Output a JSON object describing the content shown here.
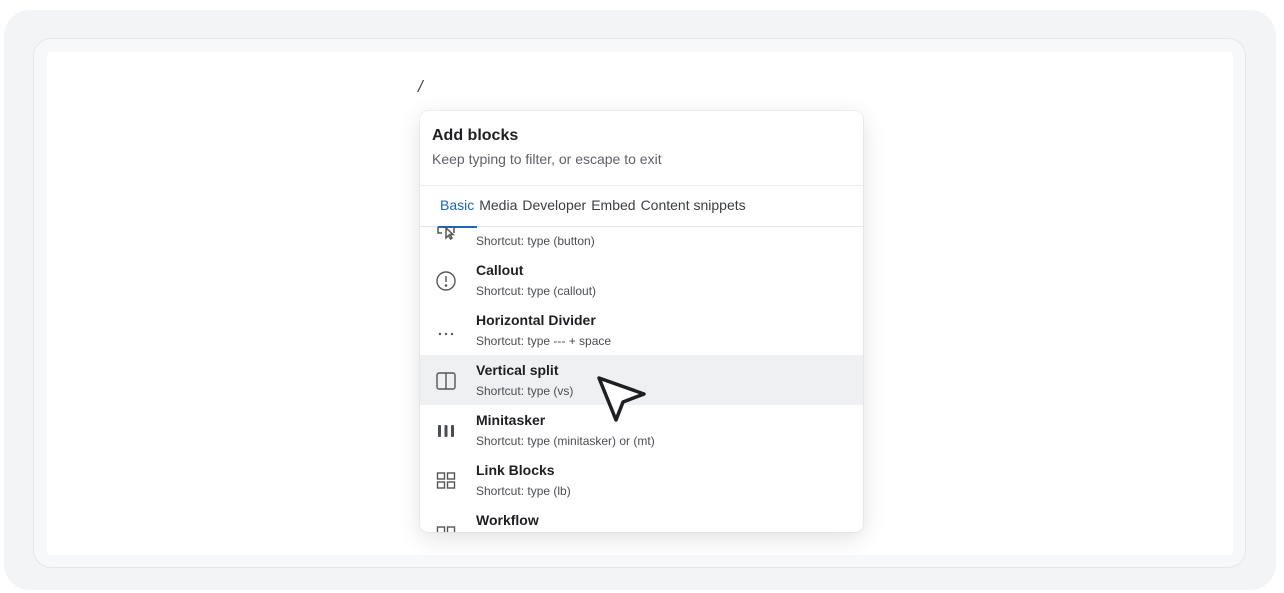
{
  "editor": {
    "slash": "/"
  },
  "menu": {
    "title": "Add blocks",
    "subtitle": "Keep typing to filter, or escape to exit",
    "tabs": [
      "Basic",
      "Media",
      "Developer",
      "Embed",
      "Content snippets"
    ],
    "active_tab": "Basic",
    "items": [
      {
        "name": "",
        "shortcut": "Shortcut: type (button)",
        "icon": "button-cursor-icon"
      },
      {
        "name": "Callout",
        "shortcut": "Shortcut: type (callout)",
        "icon": "exclamation-circle-icon"
      },
      {
        "name": "Horizontal Divider",
        "shortcut": "Shortcut: type --- + space",
        "icon": "ellipsis-icon"
      },
      {
        "name": "Vertical split",
        "shortcut": "Shortcut: type (vs)",
        "icon": "split-columns-icon"
      },
      {
        "name": "Minitasker",
        "shortcut": "Shortcut: type (minitasker) or (mt)",
        "icon": "three-bars-icon"
      },
      {
        "name": "Link Blocks",
        "shortcut": "Shortcut: type (lb)",
        "icon": "grid-icon"
      },
      {
        "name": "Workflow",
        "shortcut": "",
        "icon": "workflow-icon"
      }
    ]
  },
  "colors": {
    "accent": "#1f67b5",
    "highlight": "#eef0f2"
  }
}
